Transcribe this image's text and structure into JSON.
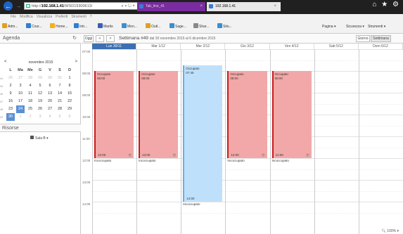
{
  "browser": {
    "url_host": "http://192.168.1.41/WSD19300613/",
    "url_prefix": "http://",
    "url_bold": "192.168.1.41",
    "url_suffix": "/WSD19300613/",
    "tab1_title": "Tab_line_41",
    "tab2_title": "192.168.1.41",
    "close_glyph": "×",
    "menu": [
      "File",
      "Modifica",
      "Visualizza",
      "Preferiti",
      "Strumenti",
      "?"
    ],
    "favorites": [
      "Adm...",
      "Cour...",
      "Home...",
      "Intr...",
      "Martis",
      "Mon...",
      "Outl...",
      "Sage...",
      "Shar...",
      "Sito..."
    ],
    "commands": [
      "Pagina ▾",
      "Sicurezza ▾",
      "Strumenti ▾"
    ],
    "zoom": "100%"
  },
  "sidebar": {
    "title": "Agenda",
    "month_title": "novembre 2015",
    "prev": "<",
    "next": ">",
    "dow": [
      "L",
      "Ma",
      "Me",
      "G",
      "V",
      "S",
      "D"
    ],
    "weeks": [
      {
        "wk": "44",
        "days": [
          "26",
          "27",
          "28",
          "29",
          "30",
          "31",
          "1"
        ],
        "other": [
          true,
          true,
          true,
          true,
          true,
          true,
          false
        ]
      },
      {
        "wk": "45",
        "days": [
          "2",
          "3",
          "4",
          "5",
          "6",
          "7",
          "8"
        ],
        "other": [
          false,
          false,
          false,
          false,
          false,
          false,
          false
        ]
      },
      {
        "wk": "46",
        "days": [
          "9",
          "10",
          "11",
          "12",
          "13",
          "14",
          "15"
        ],
        "other": [
          false,
          false,
          false,
          false,
          false,
          false,
          false
        ]
      },
      {
        "wk": "47",
        "days": [
          "16",
          "17",
          "18",
          "19",
          "20",
          "21",
          "22"
        ],
        "other": [
          false,
          false,
          false,
          false,
          false,
          false,
          false
        ]
      },
      {
        "wk": "48",
        "days": [
          "23",
          "24",
          "25",
          "26",
          "27",
          "28",
          "29"
        ],
        "other": [
          false,
          false,
          false,
          false,
          false,
          false,
          false
        ]
      },
      {
        "wk": "49",
        "days": [
          "30",
          "1",
          "2",
          "3",
          "4",
          "5",
          "6"
        ],
        "other": [
          false,
          true,
          true,
          true,
          true,
          true,
          true
        ]
      }
    ],
    "selected_day": "24",
    "resources_title": "Risorse",
    "resource_item": "Sala B"
  },
  "toolbar": {
    "today": "Oggi",
    "prev": "<",
    "next": ">",
    "week_title": "Settimana #49",
    "week_range": "dal 30 novembre 2015 al 6 dicembre 2015",
    "view_day": "Giorno",
    "view_week": "Settimana"
  },
  "days": [
    "Lun 30/11",
    "Mar 1/12",
    "Mer 2/12",
    "Gio 3/12",
    "Ven 4/12",
    "Sab 5/12",
    "Dom 6/12"
  ],
  "times": [
    "07:00",
    "08:00",
    "09:00",
    "10:00",
    "11:00",
    "12:00",
    "13:00",
    "14:00"
  ],
  "events": [
    {
      "title": "Occupato",
      "start": "08:00",
      "end": "12:00",
      "day": 0
    },
    {
      "title": "Occupato",
      "start": "08:00",
      "end": "12:00",
      "day": 1
    },
    {
      "title": "Occupato",
      "start": "07:45",
      "end": "14:00",
      "day": 2
    },
    {
      "title": "Occupato",
      "start": "08:00",
      "end": "12:00",
      "day": 3
    },
    {
      "title": "Occupato",
      "start": "08:00",
      "end": "12:00",
      "day": 4
    }
  ],
  "after_labels": [
    "Incoccupato",
    "Incoccupato",
    "Incoccupato",
    "Incoccupato",
    "Incoccupato"
  ]
}
